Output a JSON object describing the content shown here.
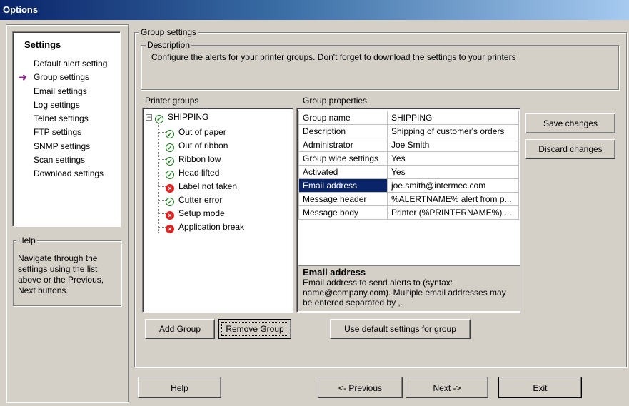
{
  "window": {
    "title": "Options"
  },
  "nav": {
    "title": "Settings",
    "items": [
      {
        "label": "Default alert setting",
        "active": false
      },
      {
        "label": "Group settings",
        "active": true
      },
      {
        "label": "Email settings",
        "active": false
      },
      {
        "label": "Log settings",
        "active": false
      },
      {
        "label": "Telnet settings",
        "active": false
      },
      {
        "label": "FTP settings",
        "active": false
      },
      {
        "label": "SNMP settings",
        "active": false
      },
      {
        "label": "Scan settings",
        "active": false
      },
      {
        "label": "Download settings",
        "active": false
      }
    ]
  },
  "help": {
    "title": "Help",
    "text": "Navigate through the settings using the list above or the Previous, Next buttons."
  },
  "group_settings": {
    "title": "Group settings",
    "description_title": "Description",
    "description": "Configure the alerts for your printer groups. Don't forget to download the settings to your printers"
  },
  "printer_groups": {
    "label": "Printer groups",
    "root": "SHIPPING",
    "items": [
      {
        "label": "Out of paper",
        "status": "ok"
      },
      {
        "label": "Out of ribbon",
        "status": "ok"
      },
      {
        "label": "Ribbon low",
        "status": "ok"
      },
      {
        "label": "Head lifted",
        "status": "ok"
      },
      {
        "label": "Label not taken",
        "status": "error"
      },
      {
        "label": "Cutter error",
        "status": "ok"
      },
      {
        "label": "Setup mode",
        "status": "error"
      },
      {
        "label": "Application break",
        "status": "error"
      }
    ]
  },
  "group_properties": {
    "label": "Group properties",
    "rows": [
      {
        "key": "Group name",
        "value": "SHIPPING"
      },
      {
        "key": "Description",
        "value": "Shipping of customer's orders"
      },
      {
        "key": "Administrator",
        "value": "Joe Smith"
      },
      {
        "key": "Group wide settings",
        "value": "Yes"
      },
      {
        "key": "Activated",
        "value": "Yes"
      },
      {
        "key": "Email address",
        "value": "joe.smith@intermec.com"
      },
      {
        "key": "Message header",
        "value": "%ALERTNAME% alert from p..."
      },
      {
        "key": "Message body",
        "value": "Printer (%PRINTERNAME%) ..."
      }
    ],
    "selected_row": 5,
    "desc_title": "Email address",
    "desc_text": "Email address to send alerts to (syntax: name@company.com). Multiple email addresses may be entered separated by ,."
  },
  "buttons": {
    "save": "Save changes",
    "discard": "Discard changes",
    "add_group": "Add Group",
    "remove_group": "Remove Group",
    "use_default": "Use default settings for group",
    "help": "Help",
    "previous": "<- Previous",
    "next": "Next ->",
    "exit": "Exit"
  },
  "colors": {
    "selection": "#0a246a",
    "ok": "#1d7a1d",
    "error": "#dd2222",
    "nav_arrow": "#8a2b8a"
  }
}
